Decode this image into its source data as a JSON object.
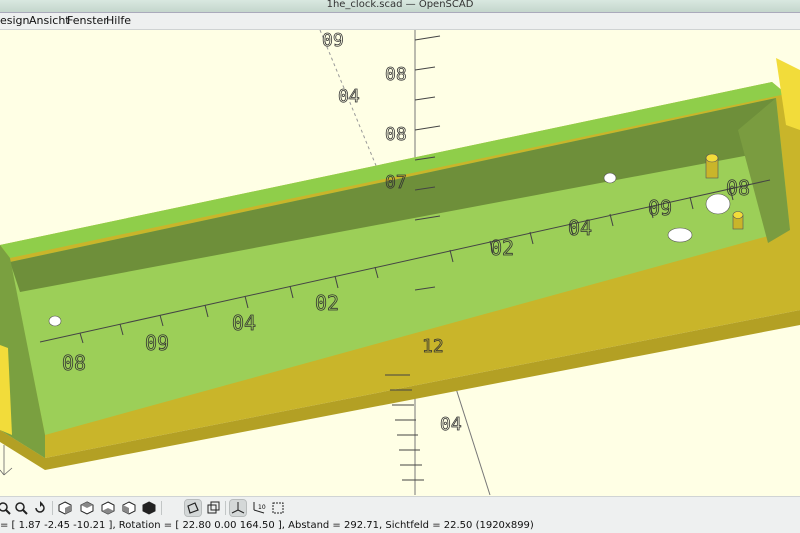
{
  "window": {
    "title": "1he_clock.scad — OpenSCAD"
  },
  "menu": {
    "items": [
      "esign",
      "Ansicht",
      "Fenster",
      "Hilfe"
    ]
  },
  "scale_labels": {
    "floor": [
      "08",
      "09",
      "04",
      "02",
      "02",
      "04",
      "09",
      "08"
    ],
    "vertical_axis": [
      "09",
      "04",
      "08",
      "08",
      "07"
    ],
    "lower_axis": [
      "12",
      "04"
    ]
  },
  "toolbar": {
    "buttons": [
      "zoom-in",
      "zoom-out",
      "reset-view",
      "view-right",
      "view-top",
      "view-bottom",
      "view-left",
      "view-front",
      "perspective",
      "orthogonal",
      "show-axes",
      "show-scale",
      "show-edges"
    ],
    "active": [
      "perspective",
      "show-axes"
    ]
  },
  "status": {
    "text": "= [ 1.87 -2.45 -10.21 ], Rotation = [ 22.80 0.00 164.50 ], Abstand = 292.71, Sichtfeld = 22.50 (1920x899)"
  },
  "colors": {
    "viewport_bg": "#ffffe5",
    "box_wall_outer": "#c9b52a",
    "box_floor": "#9ccf58",
    "box_wall_inner": "#6e8f3a",
    "box_top": "#8fce4a",
    "wall_end_edge": "#f2dc3a"
  }
}
